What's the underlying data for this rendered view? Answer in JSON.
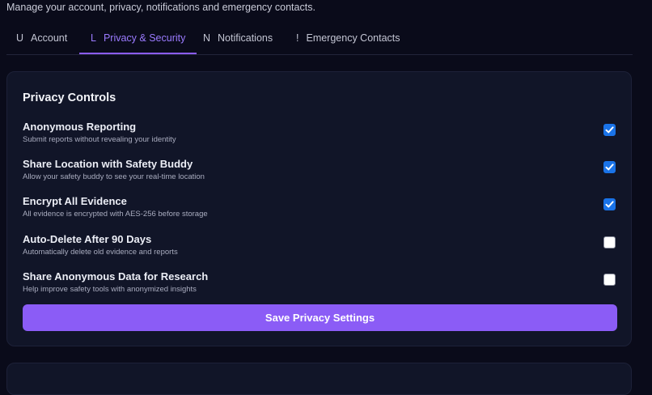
{
  "header": {
    "subtitle": "Manage your account, privacy, notifications and emergency contacts."
  },
  "tabs": [
    {
      "icon": "U",
      "label": "Account",
      "active": false
    },
    {
      "icon": "L",
      "label": "Privacy & Security",
      "active": true
    },
    {
      "icon": "N",
      "label": "Notifications",
      "active": false
    },
    {
      "icon": "!",
      "label": "Emergency Contacts",
      "active": false
    }
  ],
  "privacy": {
    "title": "Privacy Controls",
    "settings": [
      {
        "label": "Anonymous Reporting",
        "description": "Submit reports without revealing your identity",
        "checked": true
      },
      {
        "label": "Share Location with Safety Buddy",
        "description": "Allow your safety buddy to see your real-time location",
        "checked": true
      },
      {
        "label": "Encrypt All Evidence",
        "description": "All evidence is encrypted with AES-256 before storage",
        "checked": true
      },
      {
        "label": "Auto-Delete After 90 Days",
        "description": "Automatically delete old evidence and reports",
        "checked": false
      },
      {
        "label": "Share Anonymous Data for Research",
        "description": "Help improve safety tools with anonymized insights",
        "checked": false
      }
    ],
    "save_label": "Save Privacy Settings"
  },
  "colors": {
    "accent": "#8b5cf6",
    "checkbox_checked": "#1a73e8",
    "background": "#0a0b1a",
    "card": "#111528"
  }
}
